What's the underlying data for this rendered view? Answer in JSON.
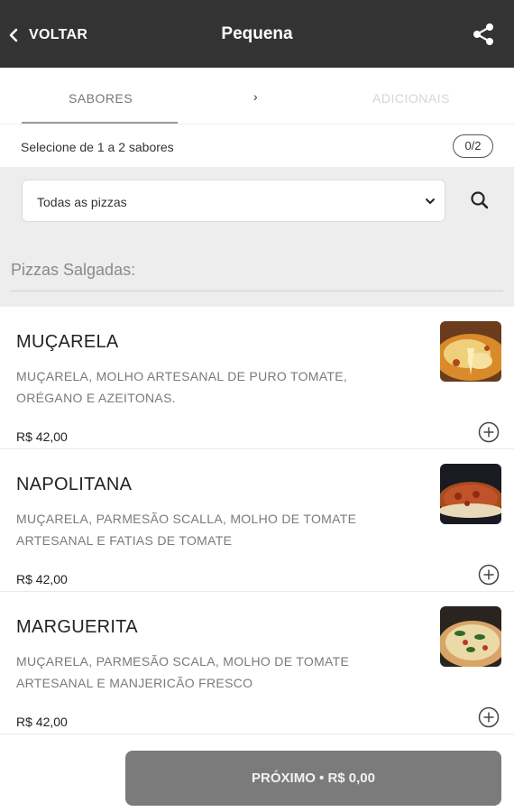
{
  "header": {
    "back_label": "VOLTAR",
    "title": "Pequena",
    "back_icon": "chevron-left-icon",
    "share_icon": "share-icon"
  },
  "steps": {
    "step1": "SABORES",
    "separator": "›",
    "step2": "ADICIONAIS"
  },
  "selection": {
    "hint": "Selecione de 1 a 2 sabores",
    "counter": "0/2"
  },
  "filter": {
    "selected": "Todas as pizzas",
    "search_icon": "search-icon"
  },
  "section": {
    "title": "Pizzas Salgadas:"
  },
  "items": [
    {
      "name": "MUÇARELA",
      "desc_line1": "MUÇARELA, MOLHO ARTESANAL DE PURO TOMATE,",
      "desc_line2": "ORÉGANO E AZEITONAS.",
      "price": "R$ 42,00"
    },
    {
      "name": "NAPOLITANA",
      "desc_line1": "MUÇARELA, PARMESÃO SCALLA, MOLHO DE TOMATE",
      "desc_line2": "ARTESANAL E FATIAS DE TOMATE",
      "price": "R$ 42,00"
    },
    {
      "name": "MARGUERITA",
      "desc_line1": "MUÇARELA, PARMESÃO SCALA, MOLHO DE TOMATE",
      "desc_line2": "ARTESANAL E MANJERICÃO FRESCO",
      "price": "R$ 42,00"
    }
  ],
  "footer": {
    "next_label": "PRÓXIMO • R$ 0,00"
  },
  "colors": {
    "topbar": "#333333",
    "button": "#7b7b7b",
    "filter_bg": "#ededed"
  }
}
